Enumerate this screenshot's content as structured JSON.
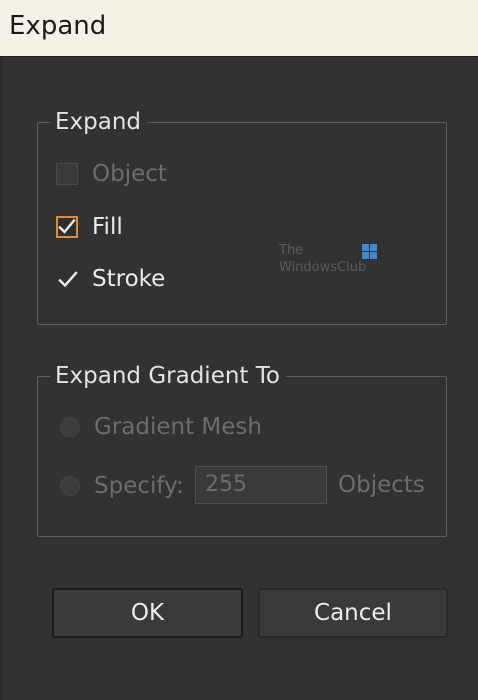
{
  "window": {
    "title": "Expand"
  },
  "expand_group": {
    "legend": "Expand",
    "options": [
      {
        "label": "Object",
        "checked": false,
        "enabled": false
      },
      {
        "label": "Fill",
        "checked": true,
        "enabled": true,
        "focused": true
      },
      {
        "label": "Stroke",
        "checked": true,
        "enabled": true
      }
    ]
  },
  "gradient_group": {
    "legend": "Expand Gradient To",
    "gradient_mesh_label": "Gradient Mesh",
    "specify_label": "Specify:",
    "specify_value": "255",
    "objects_label": "Objects",
    "enabled": false
  },
  "buttons": {
    "ok_label": "OK",
    "cancel_label": "Cancel"
  },
  "watermark": {
    "line1": "The",
    "line2": "WindowsClub",
    "logo_color": "#3c8ad6"
  },
  "colors": {
    "focus_accent": "#e08a3c",
    "dialog_bg": "#323232",
    "title_bg": "#f6f1e6"
  }
}
